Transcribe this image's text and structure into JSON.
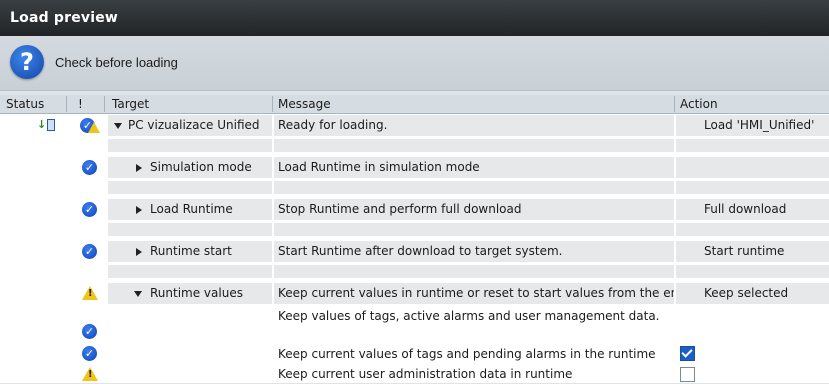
{
  "window": {
    "title": "Load preview"
  },
  "info": {
    "message": "Check before loading",
    "icon": "question-icon"
  },
  "columns": {
    "status": "Status",
    "excl": "!",
    "target": "Target",
    "message": "Message",
    "action": "Action"
  },
  "rows": [
    {
      "target": "PC vizualizace Unified",
      "message": "Ready for loading.",
      "action": "Load 'HMI_Unified'"
    },
    {
      "target": "Simulation mode",
      "message": "Load Runtime in simulation mode",
      "action": ""
    },
    {
      "target": "Load Runtime",
      "message": "Stop Runtime and perform full download",
      "action": "Full download"
    },
    {
      "target": "Runtime start",
      "message": "Start Runtime after download to target system.",
      "action": "Start runtime"
    },
    {
      "target": "Runtime values",
      "message": "Keep current values in runtime or reset to start values from the en",
      "action": "Keep selected"
    },
    {
      "target": "",
      "message": "Keep values of tags, active alarms and user management data.",
      "action": ""
    },
    {
      "target": "",
      "message": "Keep current values of tags and pending alarms in the runtime",
      "action": "",
      "checked": true
    },
    {
      "target": "",
      "message": "Keep current user administration data in runtime",
      "action": "",
      "checked": false
    }
  ]
}
